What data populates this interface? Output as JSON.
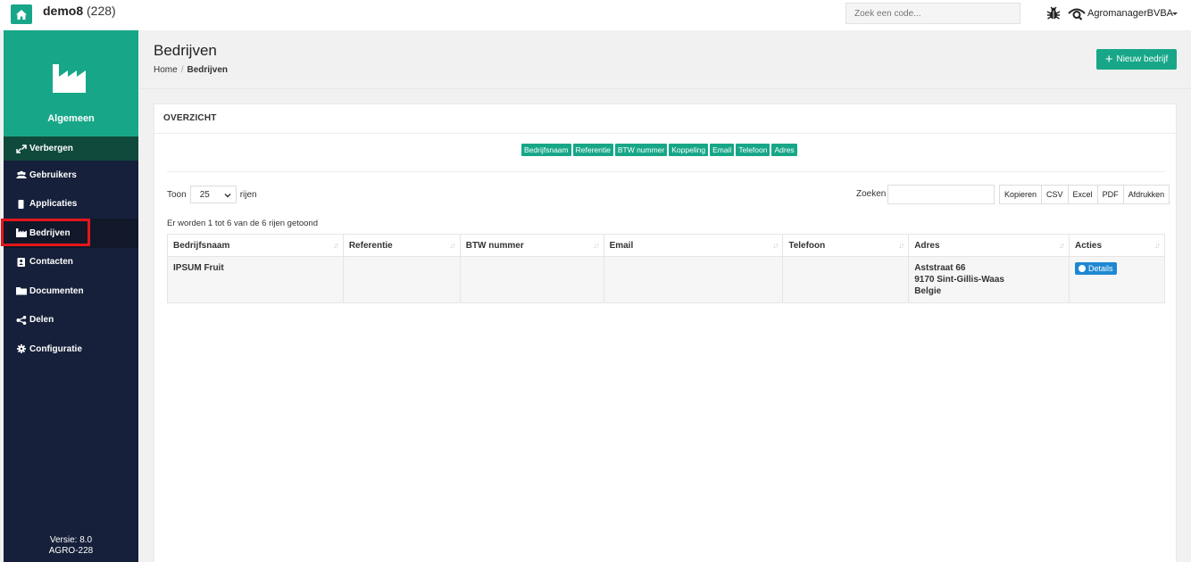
{
  "topbar": {
    "app_name": "demo8",
    "app_count": "(228)",
    "search_placeholder": "Zoek een code...",
    "user_name": "AgromanagerBVBA"
  },
  "sidebar": {
    "header_label": "Algemeen",
    "hide_label": "Verbergen",
    "items": [
      {
        "label": "Gebruikers"
      },
      {
        "label": "Applicaties"
      },
      {
        "label": "Bedrijven"
      },
      {
        "label": "Contacten"
      },
      {
        "label": "Documenten"
      },
      {
        "label": "Delen"
      },
      {
        "label": "Configuratie"
      }
    ],
    "version_line1": "Versie: 8.0",
    "version_line2": "AGRO-228"
  },
  "page": {
    "title": "Bedrijven",
    "breadcrumb": [
      "Home",
      "Bedrijven"
    ],
    "new_button": "Nieuw bedrijf"
  },
  "panel": {
    "title": "OVERZICHT",
    "column_toggles": [
      "Bedrijfsnaam",
      "Referentie",
      "BTW nummer",
      "Koppeling",
      "Email",
      "Telefoon",
      "Adres"
    ],
    "show_label": "Toon",
    "page_length": "25",
    "rows_label": "rijen",
    "search_label": "Zoeken",
    "export_buttons": [
      "Kopieren",
      "CSV",
      "Excel",
      "PDF",
      "Afdrukken"
    ],
    "info": "Er worden 1 tot 6 van de 6 rijen getoond"
  },
  "table": {
    "headers": [
      "Bedrijfsnaam",
      "Referentie",
      "BTW nummer",
      "Email",
      "Telefoon",
      "Adres",
      "Acties"
    ],
    "rows": [
      {
        "bedrijfsnaam": "IPSUM Fruit",
        "referentie": "",
        "btw": "",
        "email": "",
        "telefoon": "",
        "adres_line1": "Aststraat 66",
        "adres_line2": "9170 Sint-Gillis-Waas",
        "adres_line3": "Belgie",
        "action": "Details"
      }
    ]
  },
  "colors": {
    "brand": "#17a788",
    "sidebar": "#16203a",
    "highlight": "#e4161b",
    "details": "#1e88d3"
  },
  "icons": {
    "home": "home-icon",
    "bug": "bug-icon",
    "user": "user-eye-icon",
    "factory": "factory-icon"
  }
}
